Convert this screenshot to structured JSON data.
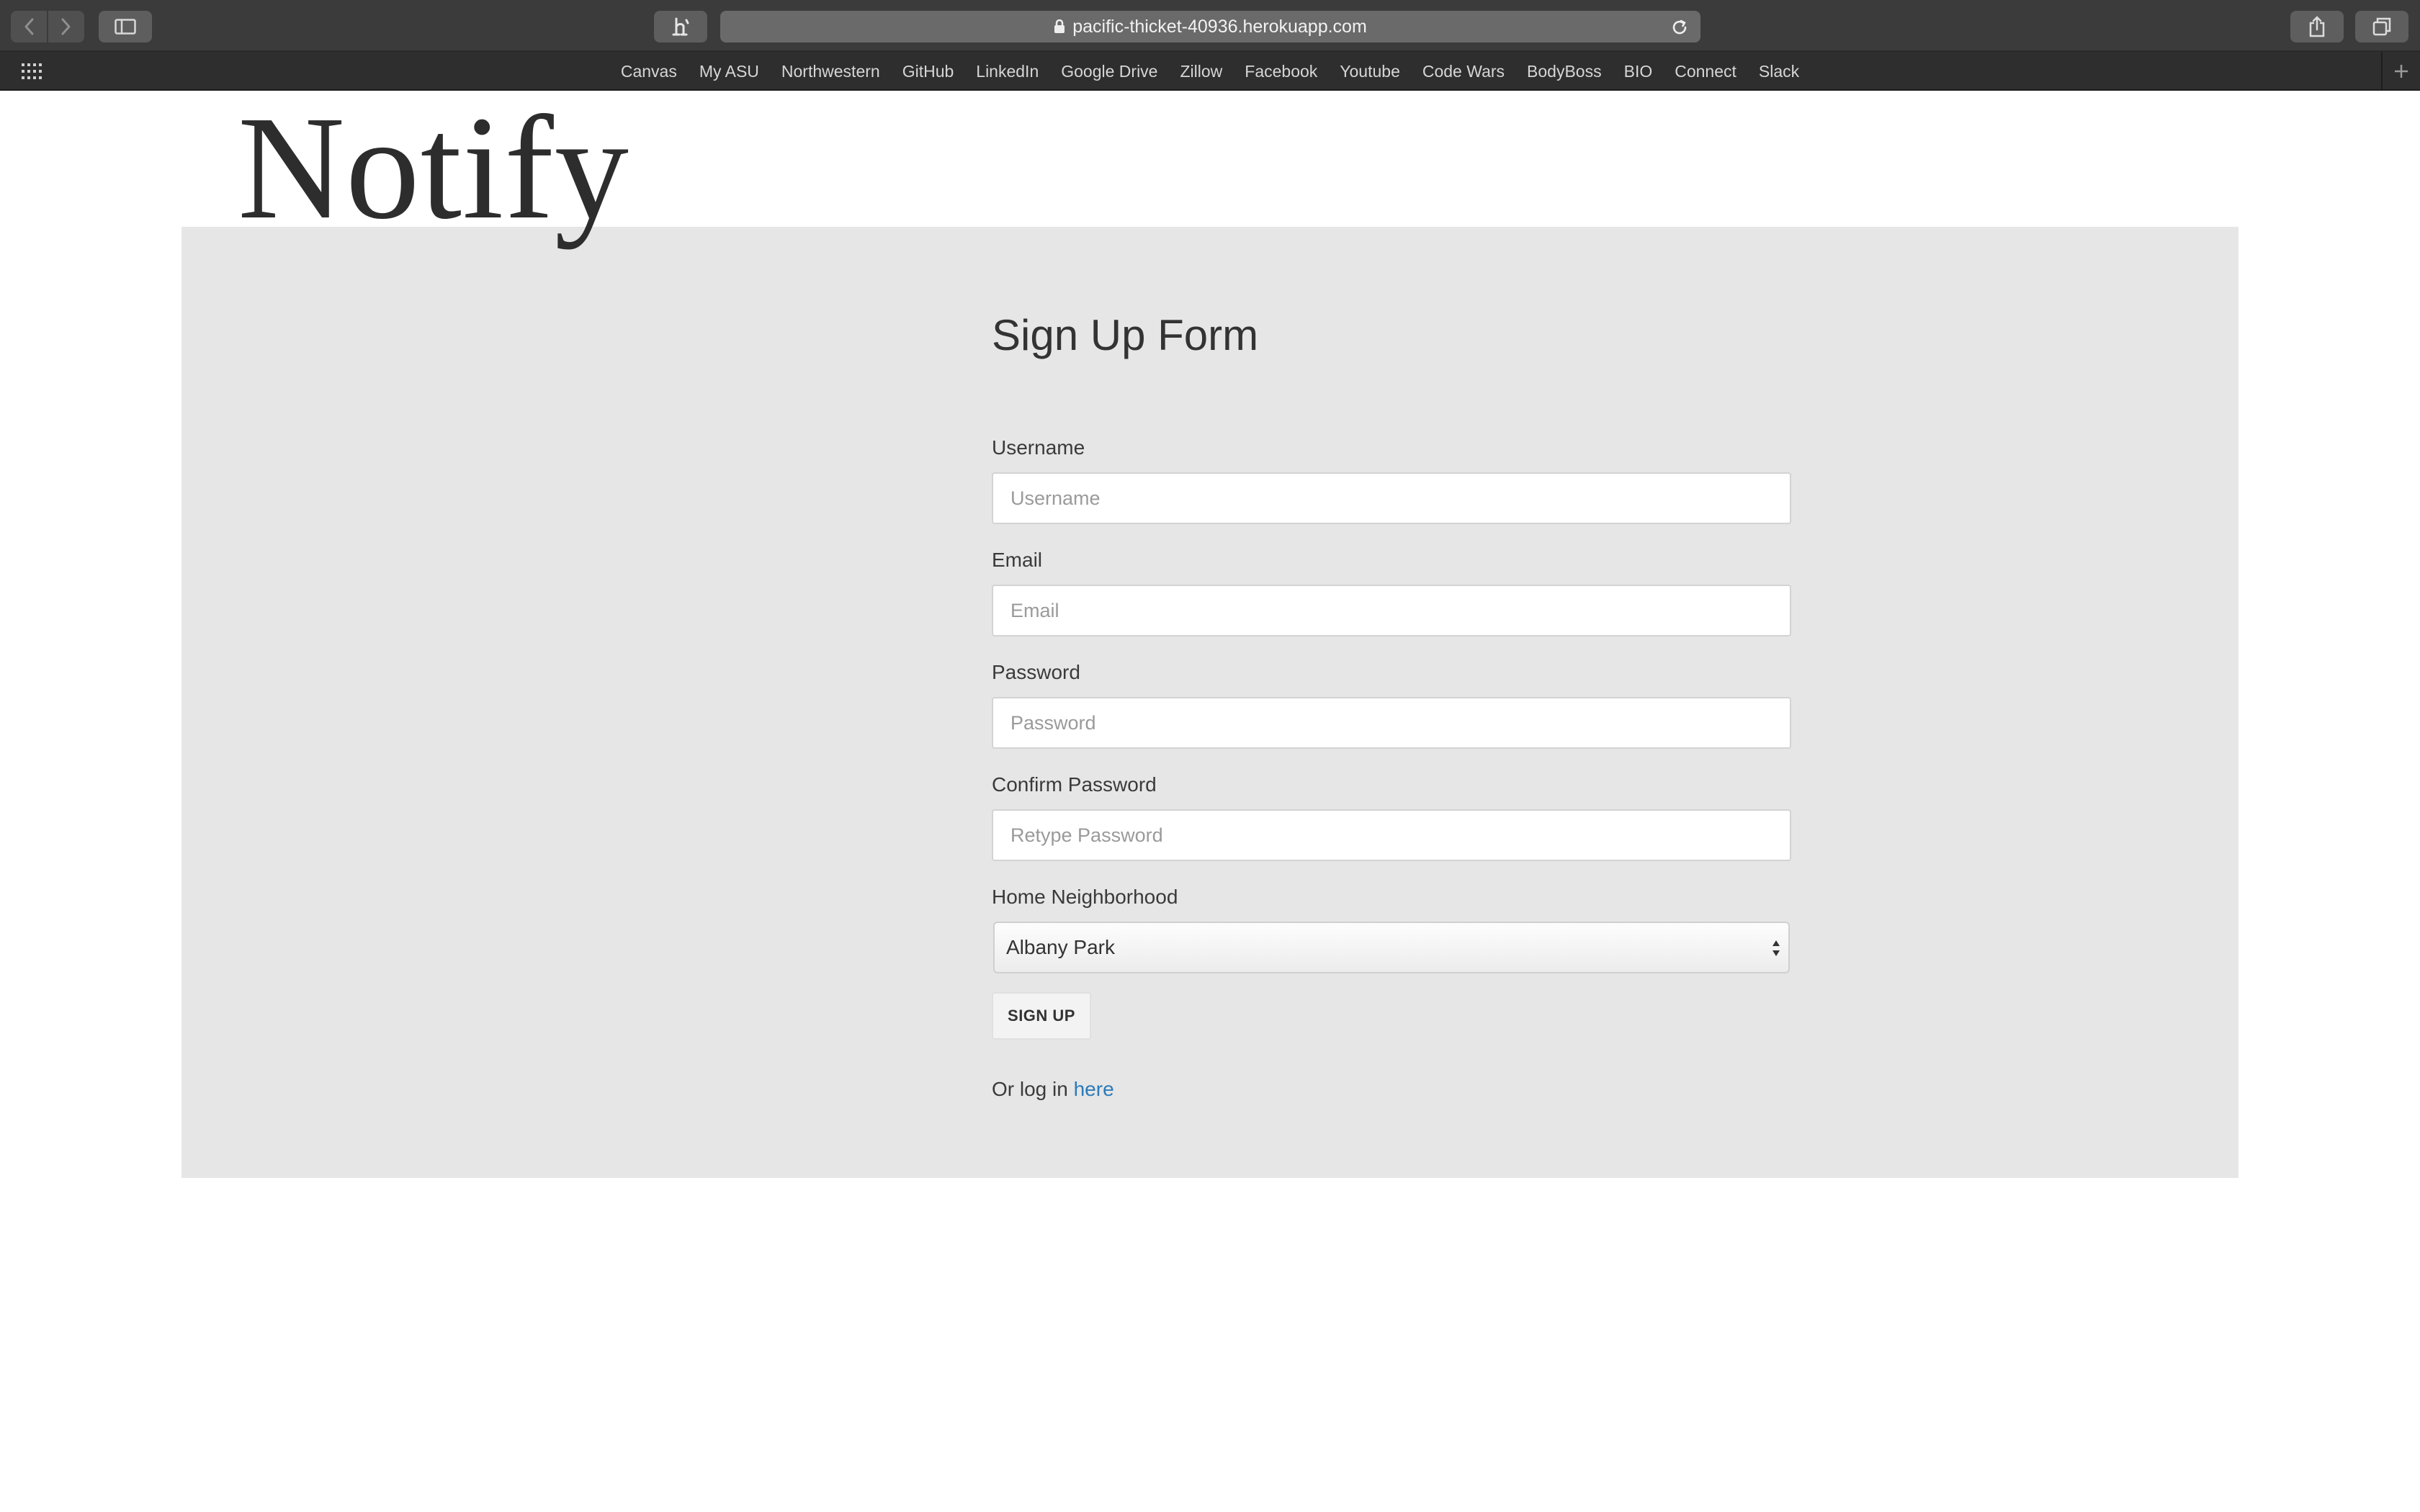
{
  "browser": {
    "url": "pacific-thicket-40936.herokuapp.com",
    "bookmarks": [
      "Canvas",
      "My ASU",
      "Northwestern",
      "GitHub",
      "LinkedIn",
      "Google Drive",
      "Zillow",
      "Facebook",
      "Youtube",
      "Code Wars",
      "BodyBoss",
      "BIO",
      "Connect",
      "Slack"
    ]
  },
  "page": {
    "logo": "Notify",
    "form_title": "Sign Up Form",
    "fields": {
      "username": {
        "label": "Username",
        "placeholder": "Username"
      },
      "email": {
        "label": "Email",
        "placeholder": "Email"
      },
      "password": {
        "label": "Password",
        "placeholder": "Password"
      },
      "confirm_password": {
        "label": "Confirm Password",
        "placeholder": "Retype Password"
      },
      "neighborhood": {
        "label": "Home Neighborhood",
        "selected": "Albany Park"
      }
    },
    "submit_label": "SIGN UP",
    "login_prefix": "Or log in",
    "login_link": "here"
  },
  "colors": {
    "panel_bg": "#e6e6e6",
    "link": "#2b7bb9",
    "chrome_toolbar": "#3b3b3b",
    "chrome_bookmarks": "#2e2e2e"
  }
}
